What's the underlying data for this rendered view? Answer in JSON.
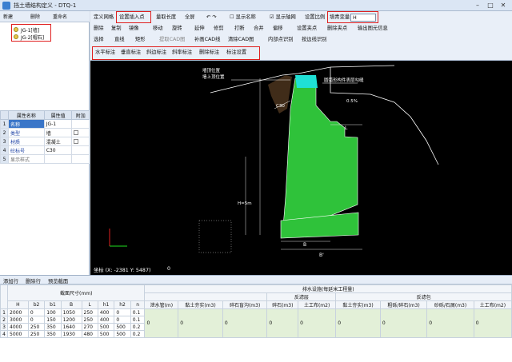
{
  "window": {
    "title": "挡土墙结构定义 - DTQ-1"
  },
  "left": {
    "toolbar": [
      "新建",
      "删除",
      "重命名"
    ],
    "tree": [
      "JG-1[墙]",
      "JG-2[帽石]"
    ],
    "props": {
      "headers": [
        "属性名称",
        "属性值",
        "附加"
      ],
      "rows": [
        {
          "n": "1",
          "name": "名称",
          "value": "JG-1"
        },
        {
          "n": "2",
          "name": "类型",
          "value": "墙"
        },
        {
          "n": "3",
          "name": "材质",
          "value": "混凝土"
        },
        {
          "n": "4",
          "name": "砼标号",
          "value": "C30"
        },
        {
          "n": "5",
          "name": "显示样式",
          "value": ""
        }
      ]
    }
  },
  "toolbar": {
    "row1": [
      "定义网格",
      "设置插入点",
      "量取长度",
      "全屏",
      "显示名称",
      "显示轴网",
      "设置比例",
      "填青变量"
    ],
    "var_value": "H",
    "row2": [
      "删除",
      "复制",
      "镜像",
      "移动",
      "旋转",
      "延伸",
      "修剪",
      "打断",
      "合并",
      "偏移",
      "设置夹点",
      "删除夹点",
      "输出图元信息"
    ],
    "row3": [
      "选择",
      "直线",
      "矩形",
      "提取CAD图",
      "补画CAD线",
      "清除CAD图",
      "内部点识别",
      "按边线识别"
    ],
    "row4": [
      "水平标注",
      "垂直标注",
      "斜边标注",
      "斜率标注",
      "删除标注",
      "标注设置"
    ]
  },
  "canvas": {
    "texts": [
      "墙顶位置",
      "墙上顶位置",
      "圆弧形构件表层勾缝",
      "C30",
      "0.5%",
      "H=5m",
      "B'",
      "B",
      "L"
    ]
  },
  "status": {
    "coords": "坐标 (X: -2381 Y: 5487)",
    "value": "0"
  },
  "bottom": {
    "toolbar": [
      "添加行",
      "删除行",
      "预览截面"
    ],
    "group1": "截面尺寸(mm)",
    "group2": "排水设施(每延米工程量)",
    "sub1": "反滤层",
    "sub2": "反滤包",
    "cols1": [
      "H",
      "b2",
      "b1",
      "B",
      "L",
      "h1",
      "h2",
      "n"
    ],
    "cols2": [
      "泄水管(m)",
      "黏土夯实(m3)",
      "碎石盲沟(m3)",
      "碎石(m3)",
      "土工布(m2)",
      "黏土夯实(m3)",
      "粗砾/碎石(m3)",
      "砂砾/石屑(m3)",
      "土工布(m2)"
    ],
    "rows": [
      [
        "1",
        "2000",
        "0",
        "100",
        "1050",
        "250",
        "400",
        "0",
        "0.1"
      ],
      [
        "2",
        "3000",
        "0",
        "150",
        "1200",
        "250",
        "400",
        "0",
        "0.1"
      ],
      [
        "3",
        "4000",
        "250",
        "350",
        "1640",
        "270",
        "500",
        "500",
        "0.2"
      ],
      [
        "4",
        "5000",
        "250",
        "350",
        "1930",
        "480",
        "500",
        "500",
        "0.2"
      ]
    ],
    "zero": "0"
  }
}
